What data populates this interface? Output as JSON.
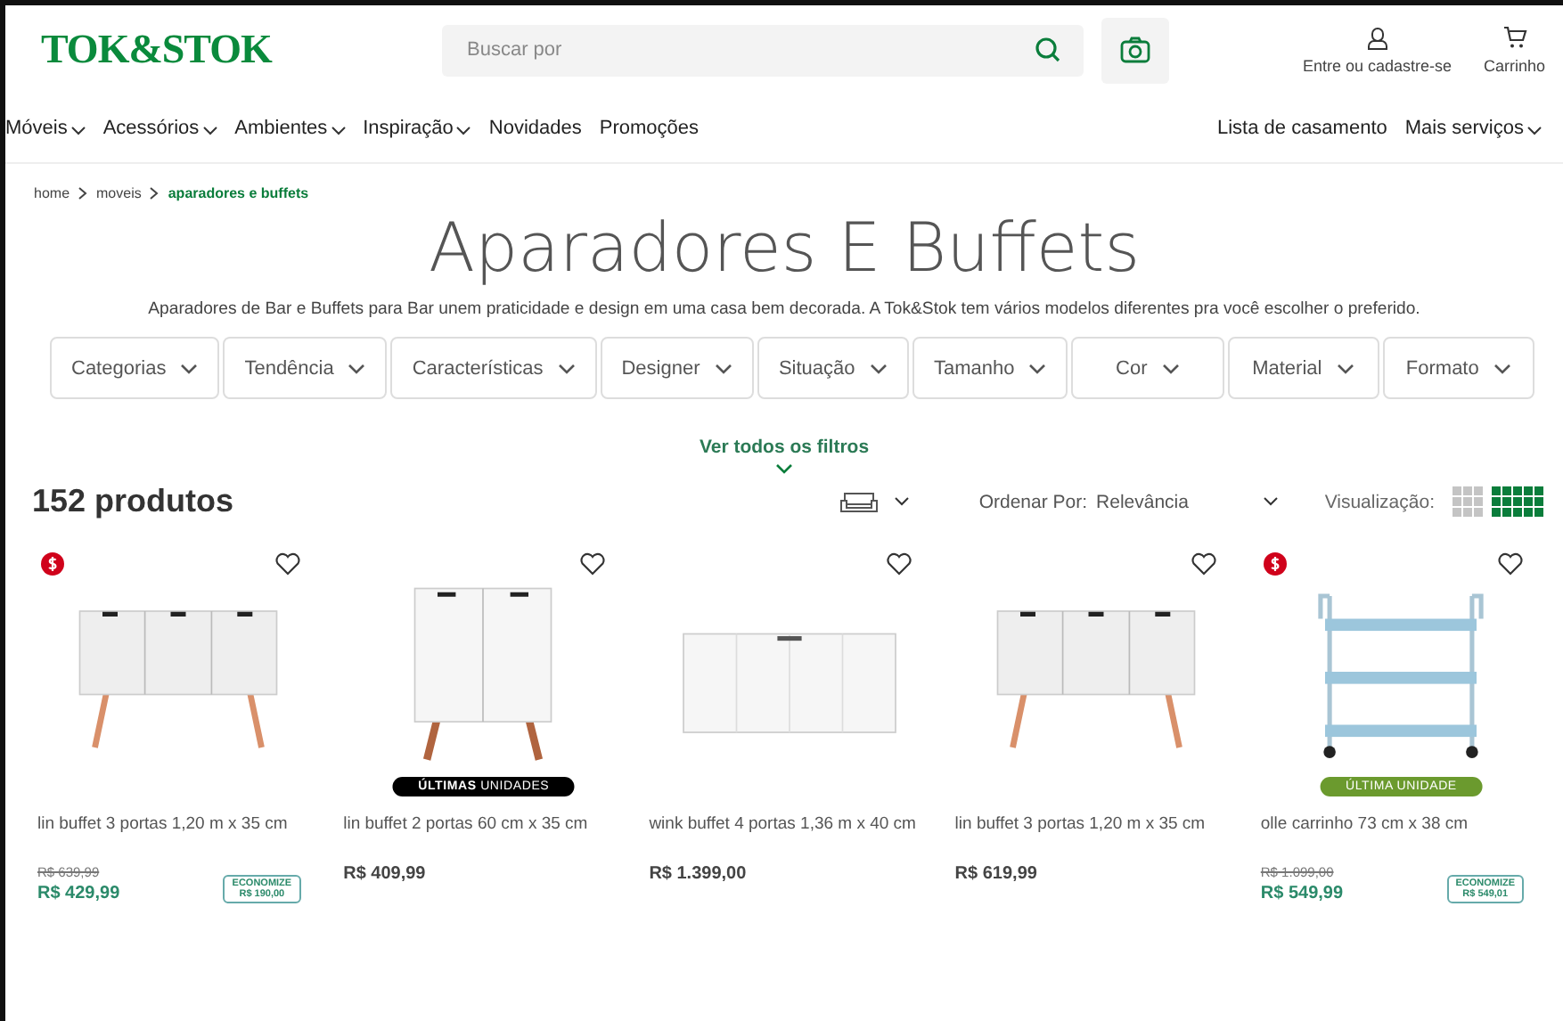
{
  "header": {
    "logo": "TOK&STOK",
    "search": {
      "placeholder": "Buscar por"
    },
    "account": "Entre ou cadastre-se",
    "cart": "Carrinho"
  },
  "nav": {
    "items": [
      {
        "label": "Móveis",
        "dropdown": true
      },
      {
        "label": "Acessórios",
        "dropdown": true
      },
      {
        "label": "Ambientes",
        "dropdown": true
      },
      {
        "label": "Inspiração",
        "dropdown": true
      },
      {
        "label": "Novidades",
        "dropdown": false
      },
      {
        "label": "Promoções",
        "dropdown": false
      }
    ],
    "right": [
      {
        "label": "Lista de casamento",
        "dropdown": false
      },
      {
        "label": "Mais serviços",
        "dropdown": true
      }
    ]
  },
  "breadcrumb": [
    {
      "label": "home",
      "selected": false
    },
    {
      "label": "moveis",
      "selected": false
    },
    {
      "label": "aparadores e buffets",
      "selected": true
    }
  ],
  "title": "Aparadores E Buffets",
  "description": "Aparadores de Bar e Buffets para Bar unem praticidade e design em uma casa bem decorada. A Tok&Stok tem vários modelos diferentes pra você escolher o preferido.",
  "filters": [
    "Categorias",
    "Tendência",
    "Características",
    "Designer",
    "Situação",
    "Tamanho",
    "Cor",
    "Material",
    "Formato"
  ],
  "all_filters": "Ver todos os filtros",
  "toolbar": {
    "count": "152 produtos",
    "sort_label": "Ordenar Por:",
    "sort_value": "Relevância",
    "view_label": "Visualização:",
    "views": [
      {
        "selected": false
      },
      {
        "selected": true
      }
    ]
  },
  "products": [
    {
      "kind": "sideboard",
      "name": "lin buffet 3 portas 1,20 m x 35 cm",
      "sale": true,
      "old_price": "R$ 639,99",
      "price": "R$ 429,99",
      "savings_label": "ECONOMIZE",
      "savings": "R$ 190,00"
    },
    {
      "kind": "cabinet",
      "name": "lin buffet 2 portas 60 cm x 35 cm",
      "sale": false,
      "badge": {
        "text": "**ÚLTIMAS** UNIDADES",
        "color": "#000000"
      },
      "price": "R$ 409,99"
    },
    {
      "kind": "buffet",
      "name": "wink buffet 4 portas 1,36 m x 40 cm",
      "sale": false,
      "price": "R$ 1.399,00"
    },
    {
      "kind": "sideboard",
      "name": "lin buffet 3 portas 1,20 m x 35 cm",
      "sale": false,
      "price": "R$ 619,99"
    },
    {
      "kind": "cart",
      "name": "olle carrinho 73 cm x 38 cm",
      "sale": true,
      "badge": {
        "text": "ÚLTIMA UNIDADE",
        "color": "#6b9a2e"
      },
      "old_price": "R$ 1.099,00",
      "price": "R$ 549,99",
      "savings_label": "ECONOMIZE",
      "savings": "R$ 549,01"
    }
  ]
}
